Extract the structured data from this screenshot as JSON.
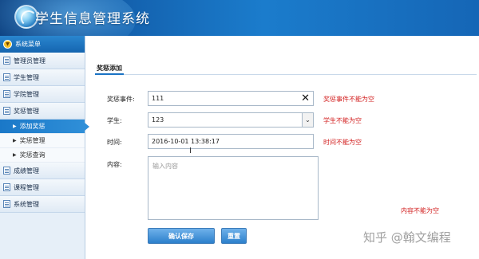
{
  "app": {
    "title": "学生信息管理系统"
  },
  "sidebar": {
    "header": "系统菜单",
    "items": [
      {
        "label": "管理员管理"
      },
      {
        "label": "学生管理"
      },
      {
        "label": "学院管理"
      },
      {
        "label": "奖惩管理",
        "children": [
          "添加奖惩",
          "奖惩管理",
          "奖惩查询"
        ]
      },
      {
        "label": "成绩管理"
      },
      {
        "label": "课程管理"
      },
      {
        "label": "系统管理"
      }
    ]
  },
  "tab": {
    "label": "奖惩添加"
  },
  "form": {
    "event": {
      "label": "奖惩事件:",
      "value": "111",
      "error": "奖惩事件不能为空"
    },
    "student": {
      "label": "学生:",
      "value": "123",
      "error": "学生不能为空"
    },
    "time": {
      "label": "时间:",
      "value": "2016-10-01 13:38:17",
      "error": "时间不能为空"
    },
    "content": {
      "label": "内容:",
      "placeholder": "输入内容",
      "error": "内容不能为空"
    },
    "save_label": "确认保存",
    "reset_label": "重置"
  },
  "watermark": "知乎 @翰文编程",
  "colors": {
    "header": "#1566b6",
    "accent": "#1a73c4",
    "error": "#d21e1e",
    "button": "#2c80cc"
  }
}
